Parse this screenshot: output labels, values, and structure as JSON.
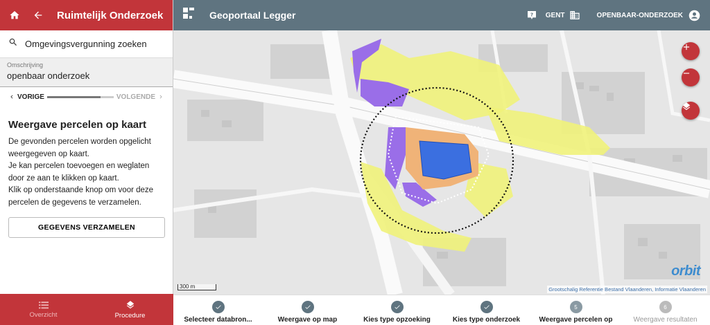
{
  "left_header": {
    "title": "Ruimtelijk Onderzoek"
  },
  "search": {
    "label": "Omgevingsvergunning zoeken"
  },
  "omschrijving": {
    "label": "Omschrijving",
    "value": "openbaar onderzoek"
  },
  "stepper": {
    "prev": "VORIGE",
    "next": "VOLGENDE",
    "progress": 0.8
  },
  "content": {
    "heading": "Weergave percelen op kaart",
    "lines": [
      "De gevonden percelen worden opgelicht",
      "weergegeven op kaart.",
      "Je kan percelen toevoegen en weglaten",
      "door ze aan te klikken op kaart.",
      "Klik op onderstaande knop om voor deze",
      "percelen de gegevens te verzamelen."
    ],
    "button": "GEGEVENS VERZAMELEN"
  },
  "footer": {
    "tabs": [
      {
        "label": "Overzicht",
        "icon": "list-icon"
      },
      {
        "label": "Procedure",
        "icon": "layers-icon"
      }
    ]
  },
  "topbar": {
    "title": "Geoportaal Legger",
    "city": "GENT",
    "user": "OPENBAAR-ONDERZOEK"
  },
  "map": {
    "scale": "300 m",
    "attribution": "Grootschalig Referentie Bestand Vlaanderen, Informatie Vlaanderen",
    "logo": "orbit"
  },
  "steps": [
    {
      "label": "Selecteer databron...",
      "status": "done"
    },
    {
      "label": "Weergave op map",
      "status": "done"
    },
    {
      "label": "Kies type opzoeking",
      "status": "done"
    },
    {
      "label": "Kies type onderzoek",
      "status": "done"
    },
    {
      "label": "Weergave percelen op",
      "status": "current",
      "number": "5"
    },
    {
      "label": "Weergave resultaten",
      "status": "pending",
      "number": "6"
    }
  ],
  "colors": {
    "brand_red": "#c2353a",
    "topbar": "#5f7480"
  }
}
